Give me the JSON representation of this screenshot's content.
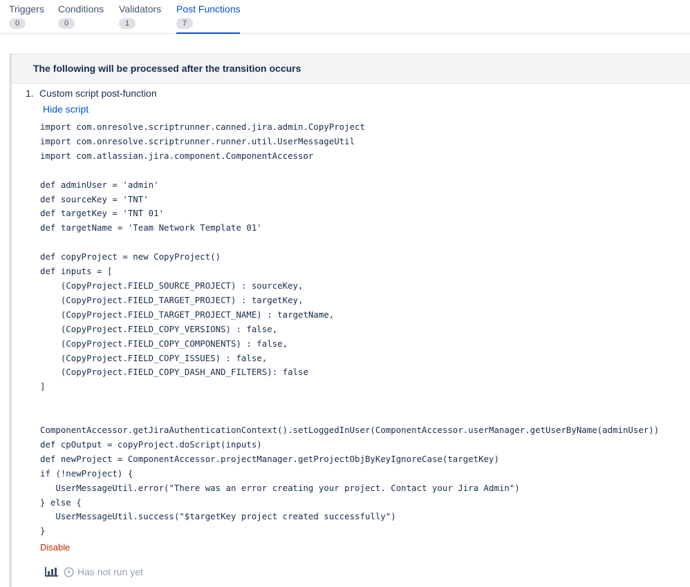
{
  "tabs": [
    {
      "label": "Triggers",
      "count": "0"
    },
    {
      "label": "Conditions",
      "count": "0"
    },
    {
      "label": "Validators",
      "count": "1"
    },
    {
      "label": "Post Functions",
      "count": "7"
    }
  ],
  "active_tab": "Post Functions",
  "panel": {
    "header": "The following will be processed after the transition occurs",
    "item": {
      "number": "1.",
      "title": "Custom script post-function",
      "hide_script_label": "Hide script",
      "code": "import com.onresolve.scriptrunner.canned.jira.admin.CopyProject\nimport com.onresolve.scriptrunner.runner.util.UserMessageUtil\nimport com.atlassian.jira.component.ComponentAccessor\n\ndef adminUser = 'admin'\ndef sourceKey = 'TNT'\ndef targetKey = 'TNT 01'\ndef targetName = 'Team Network Template 01'\n\ndef copyProject = new CopyProject()\ndef inputs = [\n    (CopyProject.FIELD_SOURCE_PROJECT) : sourceKey,\n    (CopyProject.FIELD_TARGET_PROJECT) : targetKey,\n    (CopyProject.FIELD_TARGET_PROJECT_NAME) : targetName,\n    (CopyProject.FIELD_COPY_VERSIONS) : false,\n    (CopyProject.FIELD_COPY_COMPONENTS) : false,\n    (CopyProject.FIELD_COPY_ISSUES) : false,\n    (CopyProject.FIELD_COPY_DASH_AND_FILTERS): false\n]\n\n\nComponentAccessor.getJiraAuthenticationContext().setLoggedInUser(ComponentAccessor.userManager.getUserByName(adminUser))\ndef cpOutput = copyProject.doScript(inputs)\ndef newProject = ComponentAccessor.projectManager.getProjectObjByKeyIgnoreCase(targetKey)\nif (!newProject) {\n   UserMessageUtil.error(\"There was an error creating your project. Contact your Jira Admin\")\n} else {\n   UserMessageUtil.success(\"$targetKey project created successfully\")\n}",
      "disable_label": "Disable",
      "status_text": "Has not run yet",
      "icons": [
        "bar-chart-icon",
        "clock-icon"
      ]
    }
  },
  "colors": {
    "accent": "#0052cc",
    "text": "#172b4d",
    "muted": "#97a0af",
    "danger": "#bf2600",
    "header_bg": "#f4f5f7",
    "border": "#dfe1e6"
  }
}
